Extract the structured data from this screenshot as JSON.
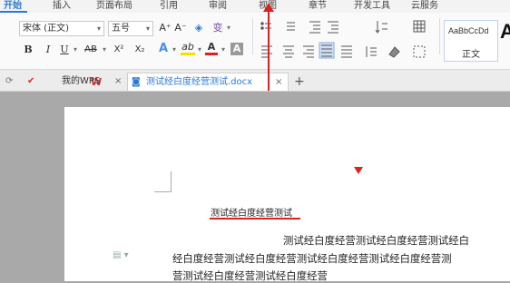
{
  "menu": {
    "items": [
      "开始",
      "插入",
      "页面布局",
      "引用",
      "审阅",
      "视图",
      "章节",
      "开发工具",
      "云服务"
    ],
    "active_index": 0
  },
  "ribbon": {
    "font_name": "宋体 (正文)",
    "font_size": "五号",
    "grow_font": "A⁺",
    "shrink_font": "A⁻",
    "clear_format": "◈",
    "phonetic": "变",
    "bold": "B",
    "italic": "I",
    "underline": "U",
    "strikethrough": "AB",
    "superscript": "X²",
    "subscript": "X₂",
    "text_effect": "A",
    "highlight": "ab",
    "font_color": "A",
    "char_shade": "A",
    "style_sample": "AaBbCcDd",
    "style_name": "正文",
    "style_big": "A",
    "colors": {
      "accent": "#2b79d6",
      "highlight_yellow": "#f6e000",
      "font_red": "#e02020",
      "annotation_red": "#e02020"
    }
  },
  "tabs": {
    "home": "⟳",
    "wps_label": "我的WPS",
    "doc_label": "测试经白度经营测试.docx",
    "close": "×",
    "add": "+"
  },
  "document": {
    "title": "测试经白度经营测试",
    "lines": [
      "测试经白度经营测试经白度经营测试经白",
      "经白度经营测试经白度经营测试经白度经营测试经白度经营测",
      "营测试经白度经营测试经白度经营"
    ]
  }
}
